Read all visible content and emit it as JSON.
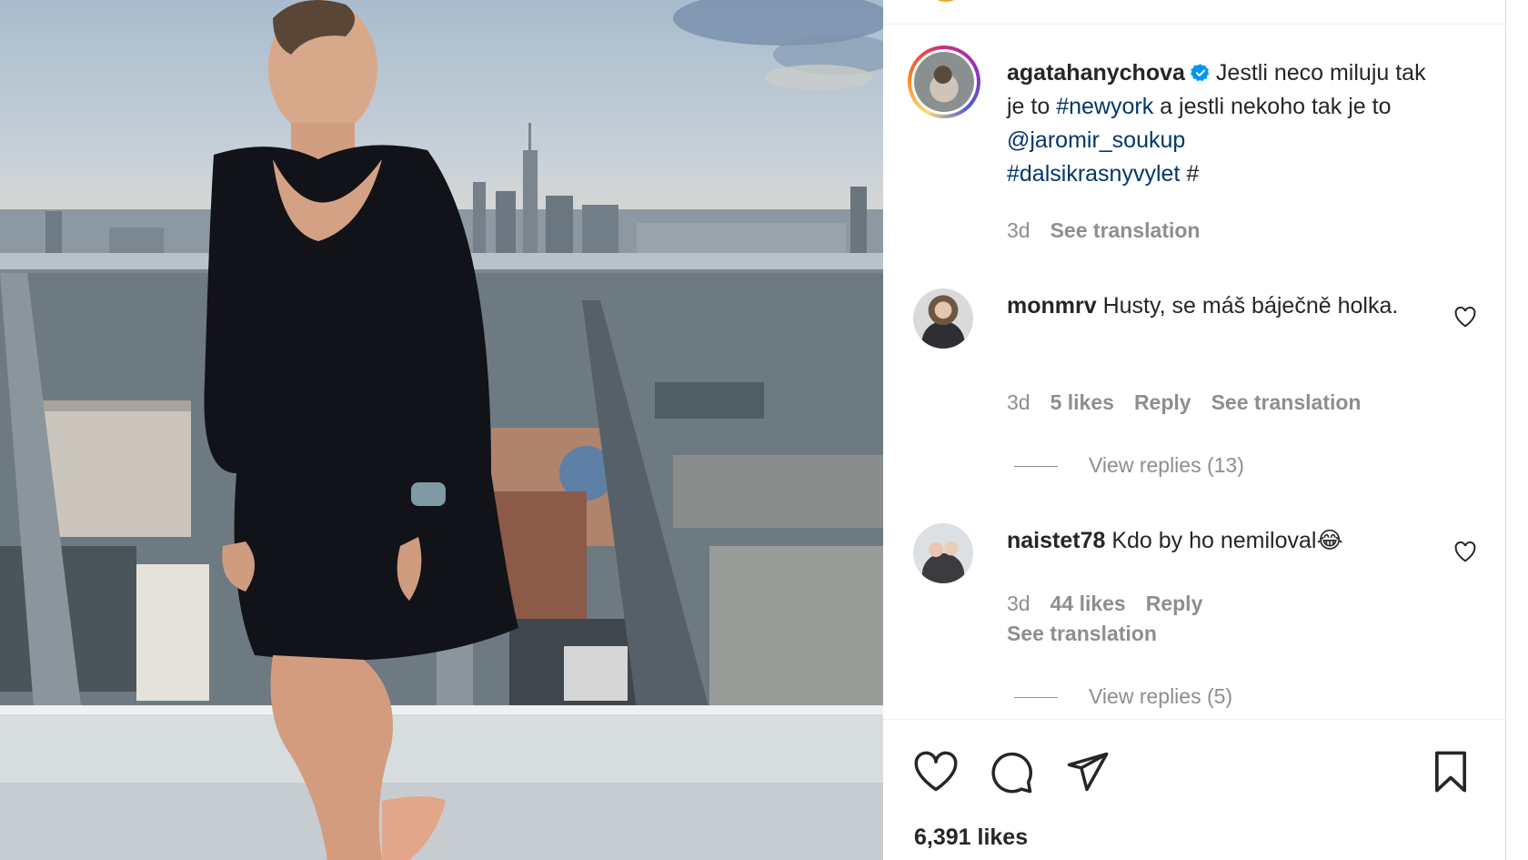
{
  "post": {
    "username": "agatahanychova",
    "caption_text": "Jestli neco miluju tak je to",
    "caption_tag1": "#newyork",
    "caption_mid": "a jestli nekoho tak je to",
    "caption_mention": "@jaromir_soukup",
    "caption_tag2": "#dalsikrasnyvylet",
    "caption_tail": "#",
    "age": "3d",
    "see_translation": "See translation"
  },
  "comments": [
    {
      "username": "monmrv",
      "text": "Husty, se máš báječně holka.",
      "age": "3d",
      "likes": "5 likes",
      "reply": "Reply",
      "see_translation": "See translation",
      "view_replies": "View replies (13)"
    },
    {
      "username": "naistet78",
      "text": "Kdo by ho nemiloval😂",
      "age": "3d",
      "likes": "44 likes",
      "reply": "Reply",
      "see_translation": "See translation",
      "view_replies": "View replies (5)"
    }
  ],
  "actions": {
    "like_icon": "heart-icon",
    "comment_icon": "comment-icon",
    "share_icon": "share-icon",
    "save_icon": "bookmark-icon"
  },
  "likes_count": "6,391 likes",
  "colors": {
    "link": "#00376b",
    "muted": "#8e8e8e",
    "verified": "#0095f6",
    "text": "#262626"
  }
}
